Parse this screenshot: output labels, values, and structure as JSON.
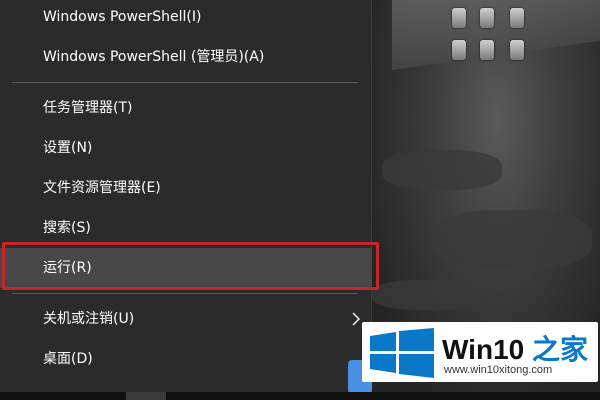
{
  "menu": {
    "items": [
      {
        "label": "Windows PowerShell(I)"
      },
      {
        "label": "Windows PowerShell (管理员)(A)"
      },
      {
        "label": "任务管理器(T)"
      },
      {
        "label": "设置(N)"
      },
      {
        "label": "文件资源管理器(E)"
      },
      {
        "label": "搜索(S)"
      },
      {
        "label": "运行(R)",
        "hovered": true
      },
      {
        "label": "关机或注销(U)",
        "submenu": true
      },
      {
        "label": "桌面(D)"
      }
    ],
    "highlight_color": "#c62428",
    "background": "#2b2b2b",
    "hover_background": "#484848"
  },
  "logo": {
    "brand_prefix": "Win10",
    "brand_suffix": "之家",
    "url": "www.win10xitong.com",
    "logo_color": "#0a78c8"
  }
}
